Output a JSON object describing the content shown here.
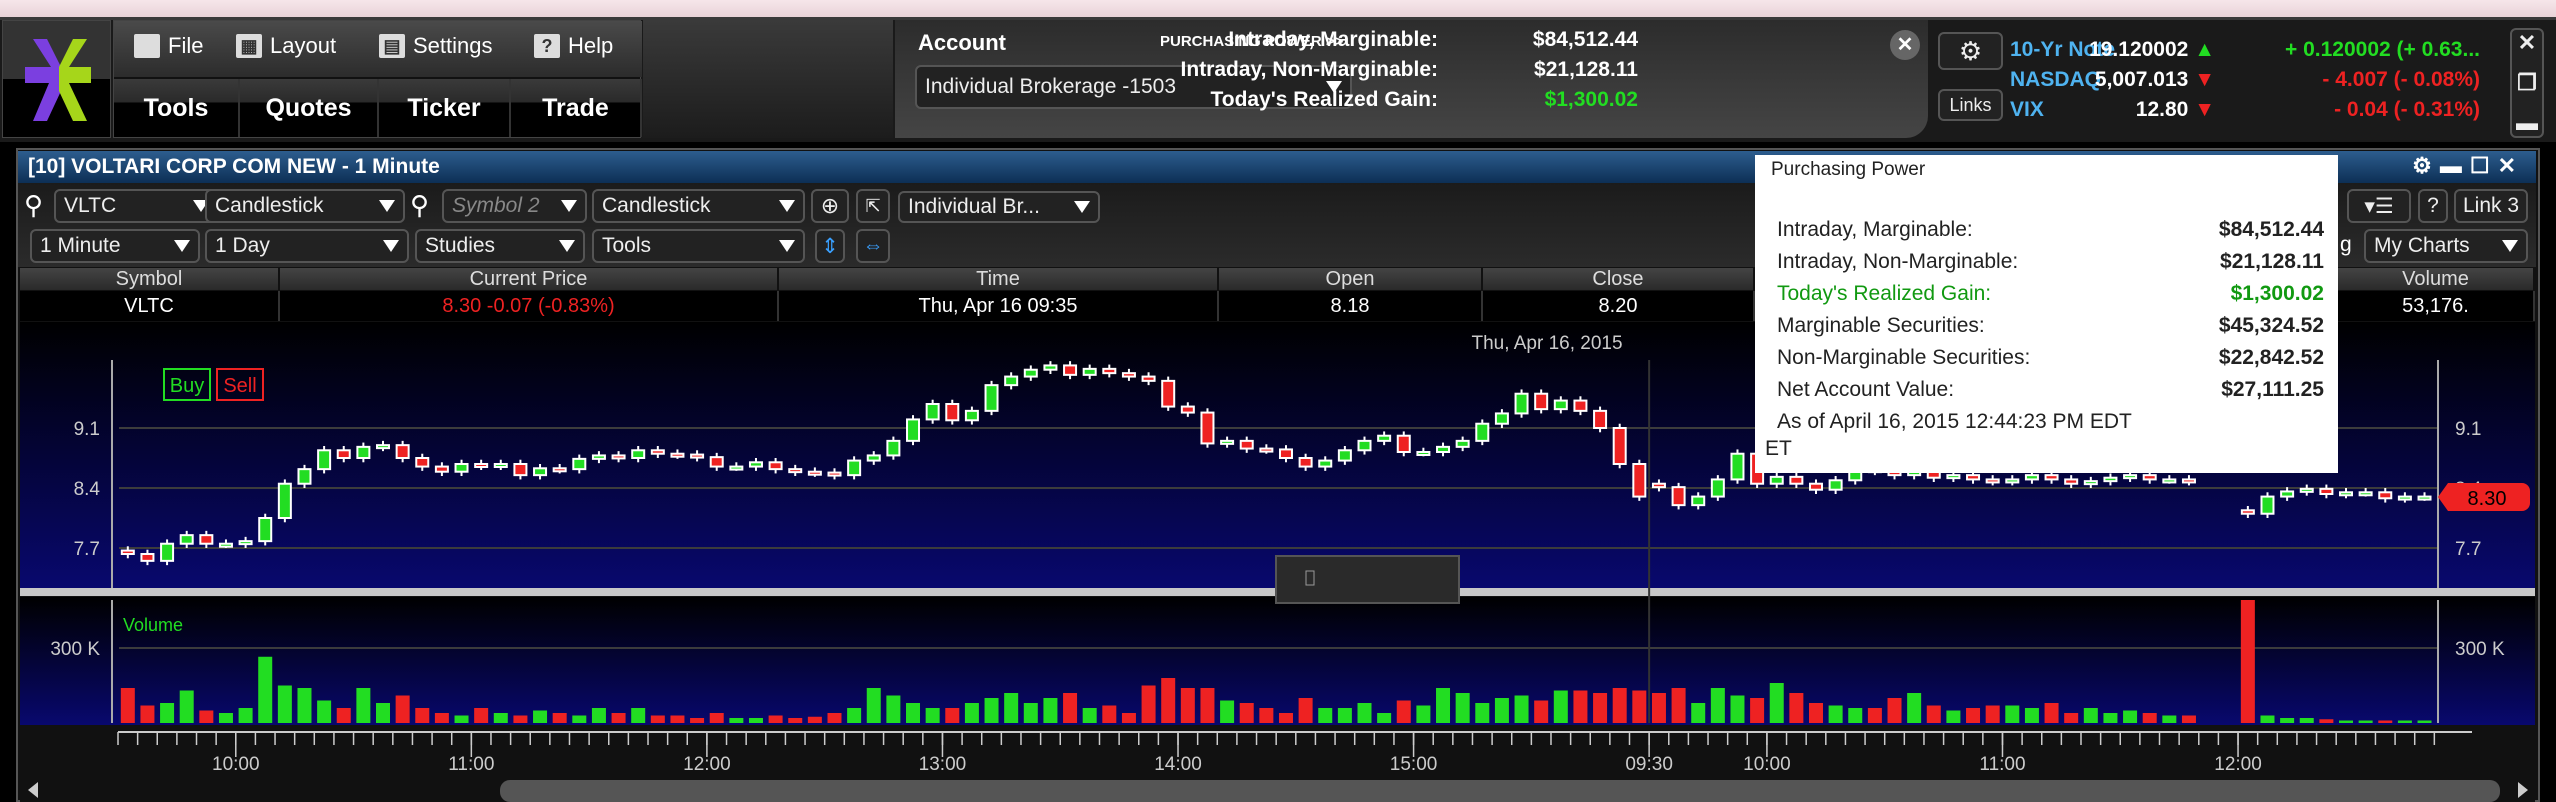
{
  "menu": {
    "file": "File",
    "layout": "Layout",
    "settings": "Settings",
    "help": "Help",
    "tools": "Tools",
    "quotes": "Quotes",
    "ticker": "Ticker",
    "trade": "Trade"
  },
  "account": {
    "label": "Account",
    "purchasing_power_link": "PURCHASING POWER >>",
    "selected": "Individual Brokerage -1503",
    "rows": [
      {
        "label": "Intraday, Marginable:",
        "value": "$84,512.44"
      },
      {
        "label": "Intraday, Non-Marginable:",
        "value": "$21,128.11"
      },
      {
        "label": "Today's Realized Gain:",
        "value": "$1,300.02"
      }
    ],
    "links_label": "Links"
  },
  "ticker": [
    {
      "name": "10-Yr Note",
      "value": "19.120002",
      "dir": "up",
      "change": "+ 0.120002 (+ 0.63..."
    },
    {
      "name": "NASDAQ",
      "value": "5,007.013",
      "dir": "down",
      "change": "- 4.007 (- 0.08%)"
    },
    {
      "name": "VIX",
      "value": "12.80",
      "dir": "down",
      "change": "- 0.04 (- 0.31%)"
    }
  ],
  "window": {
    "title": "[10] VOLTARI CORP COM NEW - 1 Minute"
  },
  "toolbar": {
    "symbol": "VLTC",
    "chart_type": "Candlestick",
    "symbol2_placeholder": "Symbol 2",
    "chart_type2": "Candlestick",
    "account": "Individual Br...",
    "interval": "1 Minute",
    "range": "1 Day",
    "studies": "Studies",
    "tools": "Tools",
    "help": "?",
    "link": "Link 3",
    "partial": "g",
    "my_charts": "My Charts"
  },
  "quote_table": {
    "headers": {
      "symbol": "Symbol",
      "price": "Current Price",
      "time": "Time",
      "open": "Open",
      "close": "Close",
      "volume": "Volume"
    },
    "row": {
      "symbol": "VLTC",
      "price": "8.30  -0.07 (-0.83%)",
      "time": "Thu, Apr 16  09:35",
      "open": "8.18",
      "close": "8.20",
      "volume": "53,176."
    }
  },
  "chart": {
    "date_label": "Thu, Apr 16, 2015",
    "buy": "Buy",
    "sell": "Sell",
    "volume_label": "Volume",
    "last_price_tag": "8.30"
  },
  "popup": {
    "title": "Purchasing Power",
    "rows": [
      {
        "label": "Intraday, Marginable:",
        "value": "$84,512.44"
      },
      {
        "label": "Intraday, Non-Marginable:",
        "value": "$21,128.11"
      },
      {
        "label": "Today's Realized Gain:",
        "value": "$1,300.02",
        "highlight": true
      },
      {
        "label": "Marginable Securities:",
        "value": "$45,324.52"
      },
      {
        "label": "Non-Marginable Securities:",
        "value": "$22,842.52"
      },
      {
        "label": "Net Account Value:",
        "value": "$27,111.25"
      }
    ],
    "asof": "As of April 16, 2015 12:44:23 PM EDT",
    "et": "ET"
  },
  "colors": {
    "up": "#22dd22",
    "down": "#ee2222",
    "accent": "#4fb3f0"
  },
  "chart_data": {
    "type": "candlestick",
    "bar_interval_minutes": 5,
    "price_ticks": [
      "9.1",
      "8.4",
      "7.7"
    ],
    "price_tick_values": [
      9.1,
      8.4,
      7.7
    ],
    "volume_ticks": [
      "300 K"
    ],
    "volume_tick_values": [
      300
    ],
    "ylim": [
      7.29,
      9.89
    ],
    "volume_ylim_k": [
      0,
      576
    ],
    "time_ticks": [
      "10:00",
      "11:00",
      "12:00",
      "13:00",
      "14:00",
      "15:00",
      "09:30",
      "10:00",
      "11:00",
      "12:00"
    ],
    "sessions": [
      {
        "start": "09:30",
        "closes": [
          7.63,
          7.55,
          7.75,
          7.85,
          7.75,
          7.75,
          7.78,
          8.05,
          8.45,
          8.62,
          8.84,
          8.75,
          8.88,
          8.9,
          8.75,
          8.65,
          8.59,
          8.68,
          8.66,
          8.68,
          8.55,
          8.63,
          8.62,
          8.74,
          8.78,
          8.75,
          8.84,
          8.8,
          8.79,
          8.76,
          8.65,
          8.65,
          8.7,
          8.62,
          8.59,
          8.58,
          8.55,
          8.72,
          8.78,
          8.95,
          9.2,
          9.38,
          9.19,
          9.3,
          9.6,
          9.7,
          9.78,
          9.83,
          9.72,
          9.79,
          9.74,
          9.7,
          9.65,
          9.35,
          9.28,
          8.92,
          8.95,
          8.86,
          8.85,
          8.75,
          8.65,
          8.72,
          8.84,
          8.95,
          9.01,
          8.82,
          8.82,
          8.88,
          8.95,
          9.15,
          9.27,
          9.5,
          9.32,
          9.42,
          9.3,
          9.1,
          8.68,
          8.3
        ],
        "volumes_k": [
          140,
          70,
          80,
          130,
          50,
          40,
          60,
          265,
          150,
          140,
          90,
          60,
          140,
          80,
          110,
          60,
          40,
          30,
          60,
          40,
          30,
          50,
          40,
          30,
          60,
          40,
          60,
          30,
          30,
          20,
          40,
          20,
          20,
          30,
          20,
          25,
          40,
          60,
          140,
          110,
          80,
          60,
          60,
          80,
          100,
          120,
          80,
          100,
          120,
          60,
          70,
          40,
          150,
          180,
          140,
          140,
          90,
          80,
          60,
          40,
          100,
          60,
          60,
          80,
          40,
          90,
          70,
          140,
          120,
          80,
          100,
          110,
          90,
          130,
          130,
          120,
          140,
          130
        ]
      },
      {
        "start": "09:30",
        "closes": [
          8.41,
          8.2,
          8.3,
          8.5,
          8.8,
          8.45,
          8.53,
          8.45,
          8.38,
          8.49,
          8.62,
          8.6,
          8.55,
          8.6,
          8.52,
          8.55,
          8.5,
          8.48,
          8.5,
          8.55,
          8.5,
          8.45,
          8.48,
          8.52,
          8.55,
          8.5,
          8.5,
          8.48,
          null,
          null,
          8.1,
          8.3,
          8.36,
          8.39,
          8.33,
          8.35,
          8.35,
          8.28,
          8.3,
          8.3
        ],
        "volumes_k": [
          120,
          140,
          80,
          140,
          110,
          100,
          160,
          120,
          80,
          70,
          60,
          60,
          100,
          120,
          70,
          50,
          60,
          70,
          70,
          60,
          80,
          40,
          60,
          40,
          50,
          40,
          30,
          30,
          0,
          0,
          560,
          30,
          20,
          20,
          15,
          10,
          10,
          10,
          10,
          10
        ]
      }
    ]
  }
}
